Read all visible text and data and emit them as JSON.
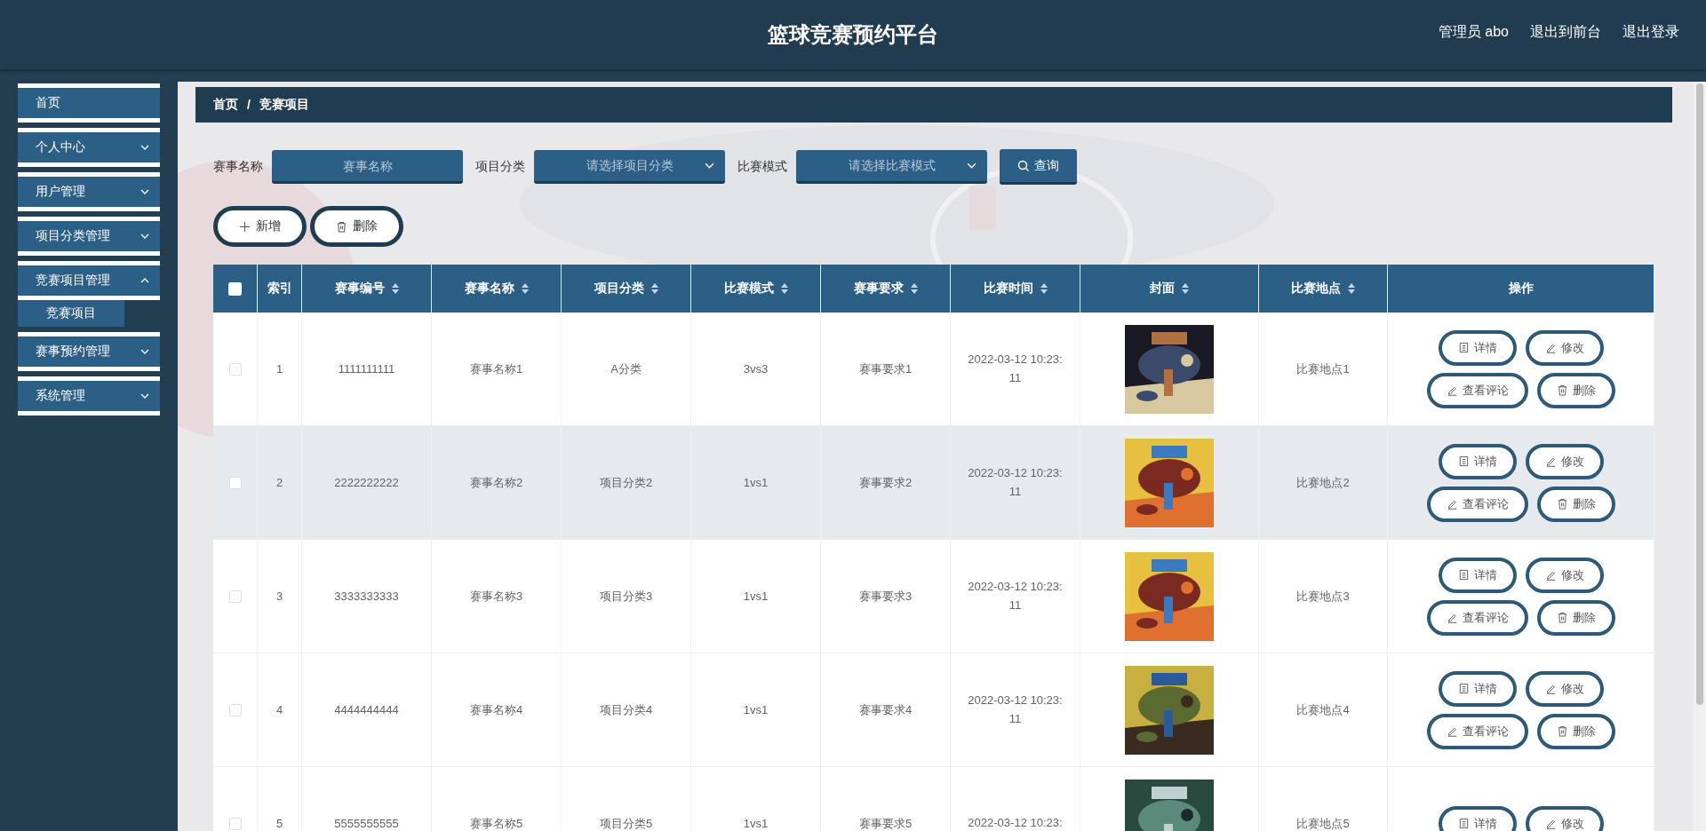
{
  "header": {
    "title": "篮球竞赛预约平台",
    "links": [
      "管理员 abo",
      "退出到前台",
      "退出登录"
    ]
  },
  "sidebar": {
    "items": [
      {
        "label": "首页",
        "kind": "link"
      },
      {
        "label": "个人中心",
        "kind": "group",
        "expanded": false
      },
      {
        "label": "用户管理",
        "kind": "group",
        "expanded": false
      },
      {
        "label": "项目分类管理",
        "kind": "group",
        "expanded": false
      },
      {
        "label": "竞赛项目管理",
        "kind": "group",
        "expanded": true,
        "children": [
          {
            "label": "竞赛项目"
          }
        ]
      },
      {
        "label": "赛事预约管理",
        "kind": "group",
        "expanded": false
      },
      {
        "label": "系统管理",
        "kind": "group",
        "expanded": false
      }
    ]
  },
  "breadcrumb": {
    "separator": "/",
    "items": [
      "首页",
      "竞赛项目"
    ]
  },
  "filters": [
    {
      "label": "赛事名称",
      "kind": "input",
      "placeholder": "赛事名称"
    },
    {
      "label": "项目分类",
      "kind": "select",
      "placeholder": "请选择项目分类"
    },
    {
      "label": "比赛模式",
      "kind": "select",
      "placeholder": "请选择比赛模式"
    }
  ],
  "search_button": "查询",
  "toolbar": [
    {
      "label": "新增",
      "kind": "add"
    },
    {
      "label": "删除",
      "kind": "delete"
    }
  ],
  "table": {
    "select_all": {
      "checked": false
    },
    "columns": [
      {
        "label": "索引",
        "sortable": false
      },
      {
        "label": "赛事编号",
        "sortable": true
      },
      {
        "label": "赛事名称",
        "sortable": true
      },
      {
        "label": "项目分类",
        "sortable": true
      },
      {
        "label": "比赛模式",
        "sortable": true
      },
      {
        "label": "赛事要求",
        "sortable": true
      },
      {
        "label": "比赛时间",
        "sortable": true
      },
      {
        "label": "封面",
        "sortable": true
      },
      {
        "label": "比赛地点",
        "sortable": true
      },
      {
        "label": "操作",
        "sortable": false
      }
    ],
    "rows": [
      {
        "checked": false,
        "hovered": false,
        "cells": [
          "1",
          "1111111111",
          "赛事名称1",
          "A分类",
          "3vs3",
          "赛事要求1",
          "2022-03-12 10:23:11"
        ],
        "cover": {
          "kind": "picture"
        },
        "place": "比赛地点1",
        "actions": [
          {
            "label": "详情",
            "kind": "detail"
          },
          {
            "label": "修改",
            "kind": "edit"
          },
          {
            "label": "查看评论",
            "kind": "edit"
          },
          {
            "label": "删除",
            "kind": "delete"
          }
        ]
      },
      {
        "checked": false,
        "hovered": true,
        "cells": [
          "2",
          "2222222222",
          "赛事名称2",
          "项目分类2",
          "1vs1",
          "赛事要求2",
          "2022-03-12 10:23:11"
        ],
        "cover": {
          "kind": "picture"
        },
        "place": "比赛地点2",
        "actions": [
          {
            "label": "详情",
            "kind": "detail"
          },
          {
            "label": "修改",
            "kind": "edit"
          },
          {
            "label": "查看评论",
            "kind": "edit"
          },
          {
            "label": "删除",
            "kind": "delete"
          }
        ]
      },
      {
        "checked": false,
        "hovered": false,
        "cells": [
          "3",
          "3333333333",
          "赛事名称3",
          "项目分类3",
          "1vs1",
          "赛事要求3",
          "2022-03-12 10:23:11"
        ],
        "cover": {
          "kind": "picture"
        },
        "place": "比赛地点3",
        "actions": [
          {
            "label": "详情",
            "kind": "detail"
          },
          {
            "label": "修改",
            "kind": "edit"
          },
          {
            "label": "查看评论",
            "kind": "edit"
          },
          {
            "label": "删除",
            "kind": "delete"
          }
        ]
      },
      {
        "checked": false,
        "hovered": false,
        "cells": [
          "4",
          "4444444444",
          "赛事名称4",
          "项目分类4",
          "1vs1",
          "赛事要求4",
          "2022-03-12 10:23:11"
        ],
        "cover": {
          "kind": "picture"
        },
        "place": "比赛地点4",
        "actions": [
          {
            "label": "详情",
            "kind": "detail"
          },
          {
            "label": "修改",
            "kind": "edit"
          },
          {
            "label": "查看评论",
            "kind": "edit"
          },
          {
            "label": "删除",
            "kind": "delete"
          }
        ]
      },
      {
        "checked": false,
        "hovered": false,
        "cells": [
          "5",
          "5555555555",
          "赛事名称5",
          "项目分类5",
          "1vs1",
          "赛事要求5",
          "2022-03-12 10:23:"
        ],
        "cover": {
          "kind": "picture"
        },
        "place": "比赛地点5",
        "actions": [
          {
            "label": "详情",
            "kind": "detail"
          },
          {
            "label": "修改",
            "kind": "edit"
          }
        ]
      }
    ]
  }
}
